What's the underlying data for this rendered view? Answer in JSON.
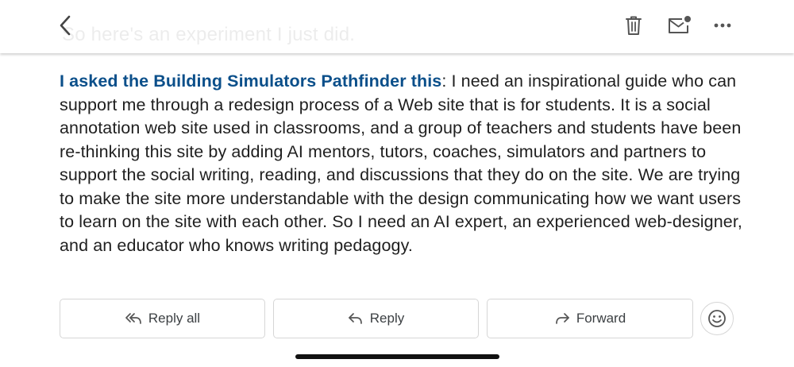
{
  "topbar": {
    "ghost_text": "So here's an experiment I just did.",
    "back_icon": "chevron-left-icon",
    "trash_icon": "trash-icon",
    "unread_icon": "mark-unread-icon",
    "more_icon": "more-horizontal-icon"
  },
  "message": {
    "link_text": "I asked the Building Simulators Pathfinder this",
    "body_text": ": I need an inspirational guide who can support me through a redesign process of a Web site that is for students. It is a social annotation web site used in classrooms, and a group of teachers and students have been re-thinking this site by adding AI mentors, tutors, coaches, simulators and partners to support the social writing, reading, and discussions that they do on the site. We are trying to make the site more understandable with the design communicating how we want users to learn on the site with each other. So I need an AI expert, an experienced web-designer, and an educator who knows writing pedagogy."
  },
  "actions": {
    "reply_all": "Reply all",
    "reply": "Reply",
    "forward": "Forward",
    "emoji_icon": "emoji-smile-icon"
  },
  "colors": {
    "link": "#0b4f8a",
    "text": "#1f1f1f",
    "border": "#d6d6d6"
  }
}
